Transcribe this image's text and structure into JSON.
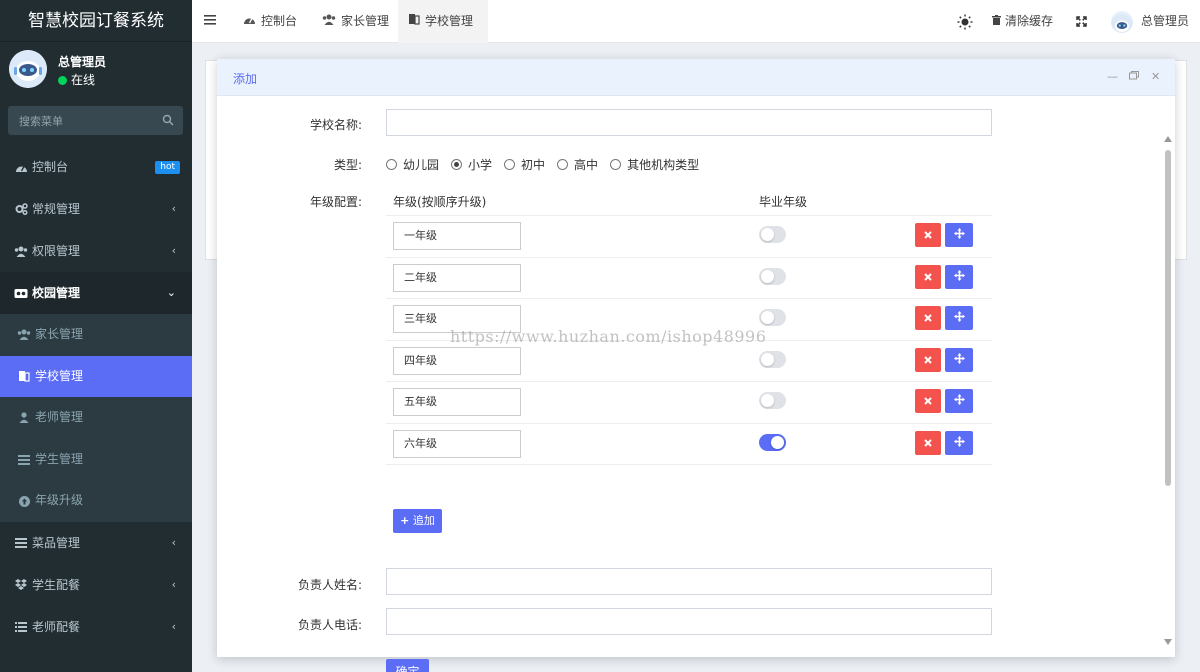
{
  "app": {
    "title": "智慧校园订餐系统"
  },
  "user": {
    "name": "总管理员",
    "status": "在线"
  },
  "search": {
    "placeholder": "搜索菜单"
  },
  "sidebar": {
    "items": [
      {
        "label": "控制台",
        "icon": "dashboard-icon",
        "badge": "hot"
      },
      {
        "label": "常规管理",
        "icon": "cogs-icon"
      },
      {
        "label": "权限管理",
        "icon": "users-icon"
      },
      {
        "label": "校园管理",
        "icon": "school-icon"
      }
    ],
    "sub_items": [
      {
        "label": "家长管理",
        "icon": "users-icon"
      },
      {
        "label": "学校管理",
        "icon": "book-icon"
      },
      {
        "label": "老师管理",
        "icon": "user-icon"
      },
      {
        "label": "学生管理",
        "icon": "list-icon"
      },
      {
        "label": "年级升级",
        "icon": "arrow-up-circle-icon"
      }
    ],
    "bottom_items": [
      {
        "label": "菜品管理",
        "icon": "list-icon"
      },
      {
        "label": "学生配餐",
        "icon": "dropbox-icon"
      },
      {
        "label": "老师配餐",
        "icon": "list-alt-icon"
      }
    ]
  },
  "topbar": {
    "tabs": [
      {
        "label": "控制台",
        "icon": "dashboard-icon"
      },
      {
        "label": "家长管理",
        "icon": "users-icon"
      },
      {
        "label": "学校管理",
        "icon": "book-icon"
      }
    ],
    "clear_cache": "清除缓存",
    "user_name": "总管理员"
  },
  "modal": {
    "title": "添加",
    "fields": {
      "school_name_label": "学校名称:",
      "type_label": "类型:",
      "grade_config_label": "年级配置:",
      "leader_name_label": "负责人姓名:",
      "leader_phone_label": "负责人电话:"
    },
    "type_options": [
      "幼儿园",
      "小学",
      "初中",
      "高中",
      "其他机构类型"
    ],
    "type_selected": "小学",
    "grade_table": {
      "col_grade": "年级(按顺序升级)",
      "col_graduate": "毕业年级",
      "rows": [
        {
          "grade": "一年级",
          "graduate": false
        },
        {
          "grade": "二年级",
          "graduate": false
        },
        {
          "grade": "三年级",
          "graduate": false
        },
        {
          "grade": "四年级",
          "graduate": false
        },
        {
          "grade": "五年级",
          "graduate": false
        },
        {
          "grade": "六年级",
          "graduate": true
        }
      ]
    },
    "append_label": "追加",
    "confirm_label": "确定"
  },
  "watermark": "https://www.huzhan.com/ishop48996"
}
